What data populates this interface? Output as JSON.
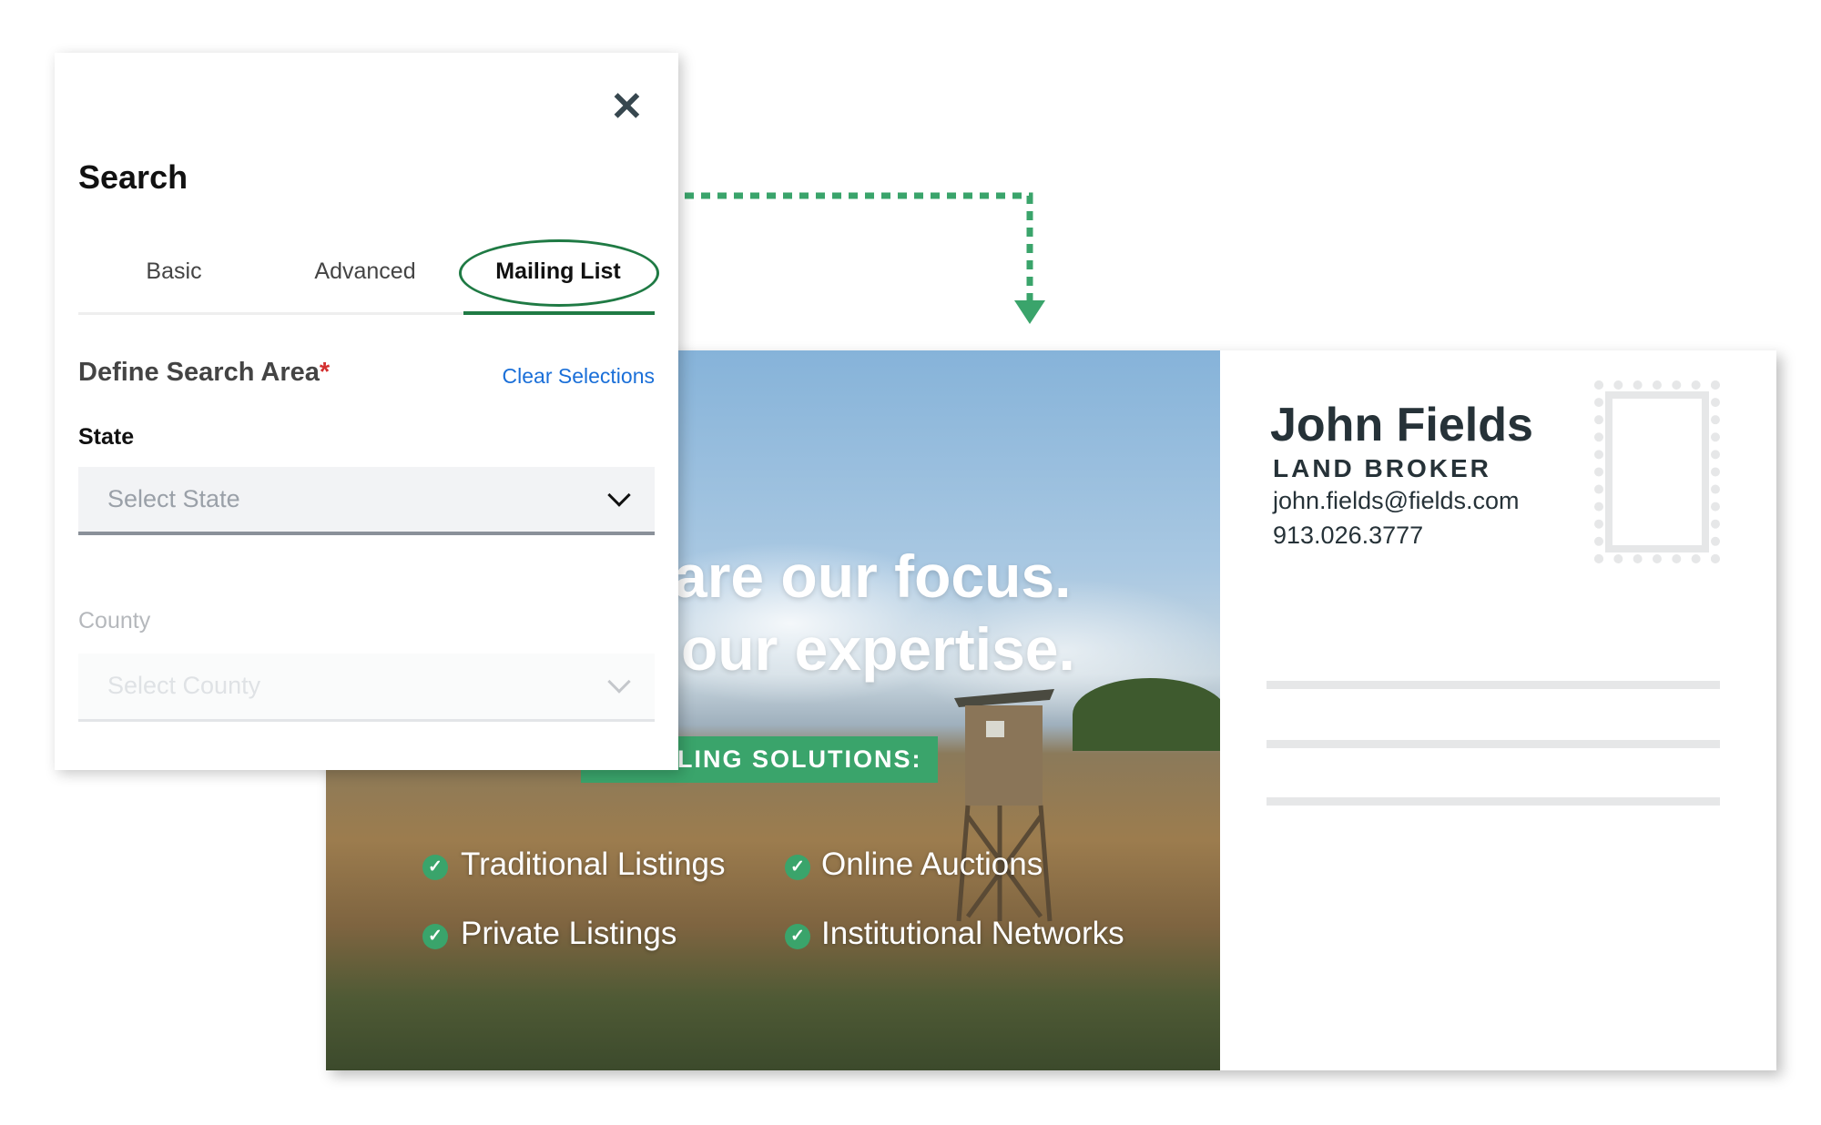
{
  "panel": {
    "title": "Search",
    "tabs": [
      {
        "label": "Basic"
      },
      {
        "label": "Advanced"
      },
      {
        "label": "Mailing List",
        "active": true
      }
    ],
    "section_title": "Define Search Area",
    "required_mark": "*",
    "clear_label": "Clear Selections",
    "state": {
      "label": "State",
      "placeholder": "Select State"
    },
    "county": {
      "label": "County",
      "placeholder": "Select County",
      "disabled": true
    }
  },
  "postcard": {
    "headline_1": "are our focus.",
    "headline_2": "our expertise.",
    "banner": "LING SOLUTIONS:",
    "features": [
      "Traditional Listings",
      "Online Auctions",
      "Private Listings",
      "Institutional Networks"
    ],
    "name": "John Fields",
    "role": "LAND BROKER",
    "email": "john.fields@fields.com",
    "phone": "913.026.3777"
  },
  "colors": {
    "accent_green": "#3aa46b",
    "tab_green": "#1f7a44",
    "link_blue": "#1a6fd8",
    "required_red": "#d32f2f"
  },
  "icons": {
    "close": "close-icon",
    "chevron": "chevron-down-icon",
    "check": "check-circle-icon",
    "arrow": "dotted-arrow-down"
  }
}
